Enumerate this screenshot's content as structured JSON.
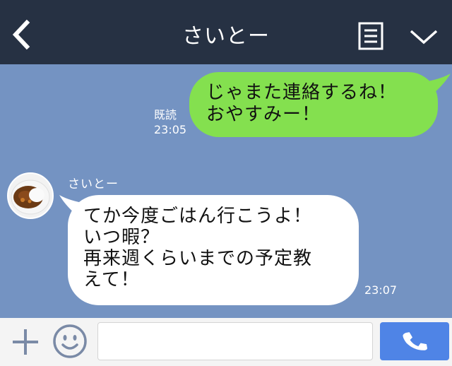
{
  "header": {
    "title": "さいとー"
  },
  "messages": {
    "outgoing": {
      "lines": [
        "じゃまた連絡するね！",
        "おやすみー！"
      ],
      "read_label": "既読",
      "time": "23:05"
    },
    "incoming": {
      "sender": "さいとー",
      "lines": [
        "てか今度ごはん行こうよ！",
        "いつ暇？",
        "再来週くらいまでの予定教",
        "えて！"
      ],
      "time": "23:07"
    }
  },
  "footer": {
    "input_value": "",
    "input_placeholder": ""
  },
  "colors": {
    "header_bg": "#263143",
    "chat_bg": "#7493c2",
    "outgoing_bubble": "#84e04f",
    "incoming_bubble": "#ffffff",
    "call_button": "#4f84e6"
  },
  "icons": {
    "back": "chevron-left-icon",
    "memo": "note-icon",
    "more": "chevron-down-icon",
    "plus": "plus-icon",
    "sticker": "smile-icon",
    "call": "phone-icon",
    "avatar": "curry-rice-avatar"
  }
}
